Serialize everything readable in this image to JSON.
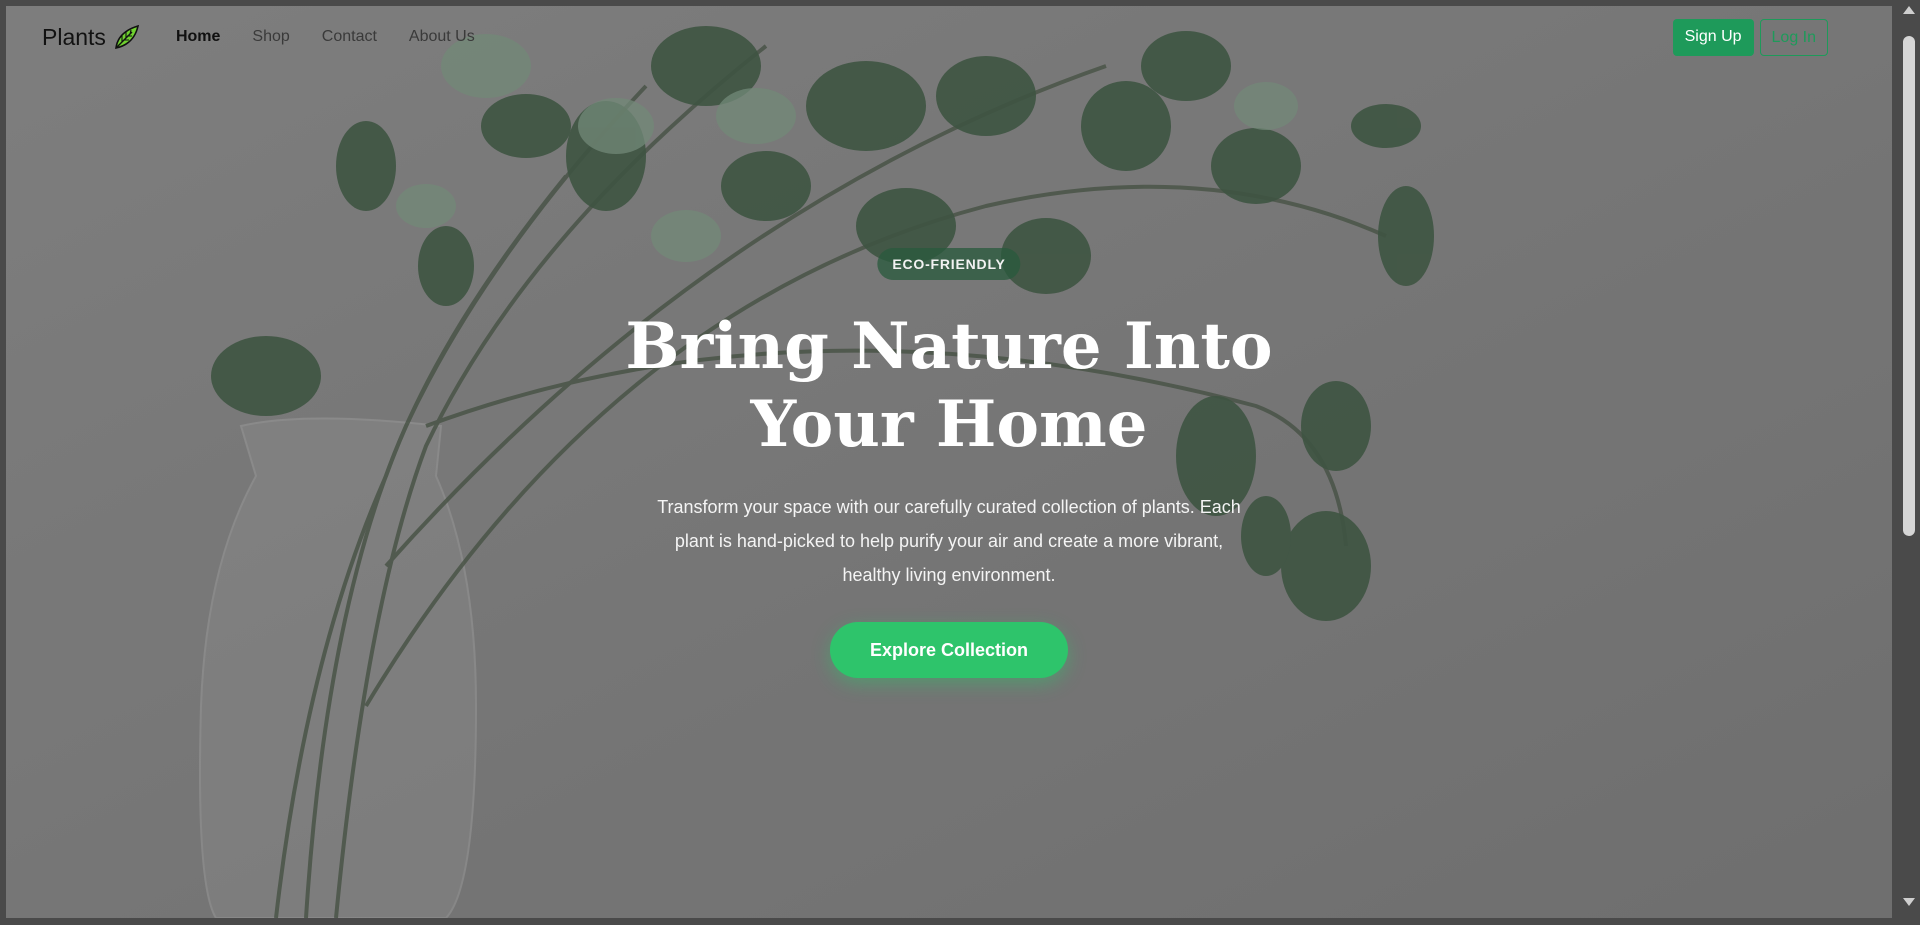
{
  "brand": {
    "name": "Plants",
    "icon": "leaf-icon"
  },
  "nav": {
    "links": [
      {
        "label": "Home",
        "active": true
      },
      {
        "label": "Shop",
        "active": false
      },
      {
        "label": "Contact",
        "active": false
      },
      {
        "label": "About Us",
        "active": false
      }
    ]
  },
  "auth": {
    "signup_label": "Sign Up",
    "login_label": "Log In"
  },
  "hero": {
    "badge": "ECO-FRIENDLY",
    "title": "Bring Nature Into Your Home",
    "description": "Transform your space with our carefully curated collection of plants. Each plant is hand-picked to help purify your air and create a more vibrant, healthy living environment.",
    "cta_label": "Explore Collection"
  },
  "colors": {
    "accent": "#1e9a5a",
    "cta": "#2ec46b",
    "badge_bg": "#285a3c"
  }
}
